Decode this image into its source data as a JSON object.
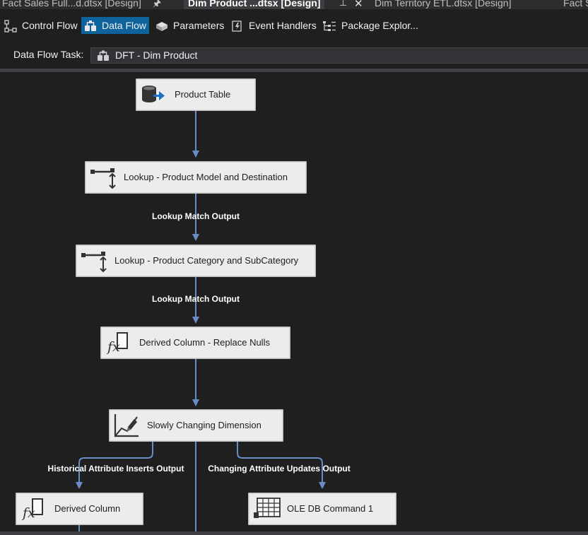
{
  "document_tabs": [
    {
      "label": "Fact Sales Full...d.dtsx [Design]",
      "active": false
    },
    {
      "label": "Dim Product ...dtsx [Design]",
      "active": true
    },
    {
      "label": "Dim Territory ETL.dtsx [Design]",
      "active": false
    },
    {
      "label": "Fact S",
      "active": false
    }
  ],
  "designer_tabs": [
    {
      "label": "Control Flow",
      "icon": "control-flow-icon",
      "active": false
    },
    {
      "label": "Data Flow",
      "icon": "data-flow-icon",
      "active": true
    },
    {
      "label": "Parameters",
      "icon": "parameters-icon",
      "active": false
    },
    {
      "label": "Event Handlers",
      "icon": "event-handlers-icon",
      "active": false
    },
    {
      "label": "Package Explor...",
      "icon": "package-explorer-icon",
      "active": false
    }
  ],
  "task": {
    "label": "Data Flow Task:",
    "value": "DFT - Dim Product"
  },
  "components": {
    "source": {
      "label": "Product Table",
      "icon": "ole-db-source-icon"
    },
    "lookup_model": {
      "label": "Lookup - Product Model and Destination",
      "icon": "lookup-icon"
    },
    "lookup_category": {
      "label": "Lookup - Product Category and SubCategory",
      "icon": "lookup-icon"
    },
    "derived_nulls": {
      "label": "Derived Column - Replace Nulls",
      "icon": "derived-column-icon"
    },
    "scd": {
      "label": "Slowly Changing Dimension",
      "icon": "scd-icon"
    },
    "derived_column": {
      "label": "Derived Column",
      "icon": "derived-column-icon"
    },
    "ole_db_command": {
      "label": "OLE DB Command 1",
      "icon": "ole-db-command-icon"
    }
  },
  "edges": {
    "match_1": "Lookup Match Output",
    "match_2": "Lookup Match Output",
    "historical": "Historical Attribute Inserts Output",
    "changing": "Changing Attribute Updates Output"
  },
  "colors": {
    "accent": "#0e639c",
    "connector": "#6a8cc6",
    "canvas": "#1f1f1f",
    "node_fill": "#ececec"
  }
}
